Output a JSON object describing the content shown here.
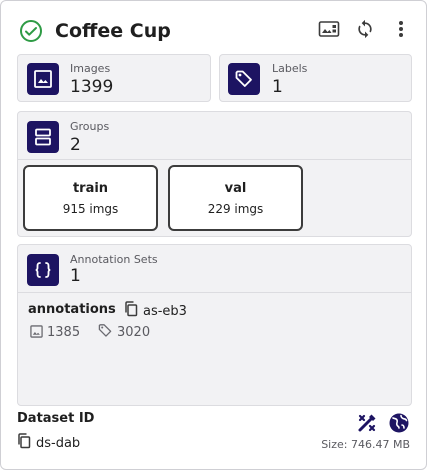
{
  "header": {
    "title": "Coffee Cup",
    "icons": [
      "check-circle-icon",
      "image-gallery-icon",
      "sync-icon",
      "more-vert-icon"
    ]
  },
  "stats": {
    "images": {
      "label": "Images",
      "value": "1399",
      "icon": "image-icon"
    },
    "labels": {
      "label": "Labels",
      "value": "1",
      "icon": "tag-icon"
    }
  },
  "groups": {
    "label": "Groups",
    "value": "2",
    "icon": "groups-icon",
    "items": [
      {
        "name": "train",
        "count": "915 imgs"
      },
      {
        "name": "val",
        "count": "229 imgs"
      }
    ]
  },
  "annotation_sets": {
    "label": "Annotation Sets",
    "value": "1",
    "icon": "braces-icon",
    "items": [
      {
        "name": "annotations",
        "id": "as-eb3",
        "images": "1385",
        "labels": "3020"
      }
    ]
  },
  "footer": {
    "dataset_label": "Dataset ID",
    "dataset_id": "ds-dab",
    "size": "Size: 746.47 MB"
  },
  "colors": {
    "accent": "#1d1462",
    "success": "#2e9b45",
    "panel_bg": "#f2f2f4"
  }
}
